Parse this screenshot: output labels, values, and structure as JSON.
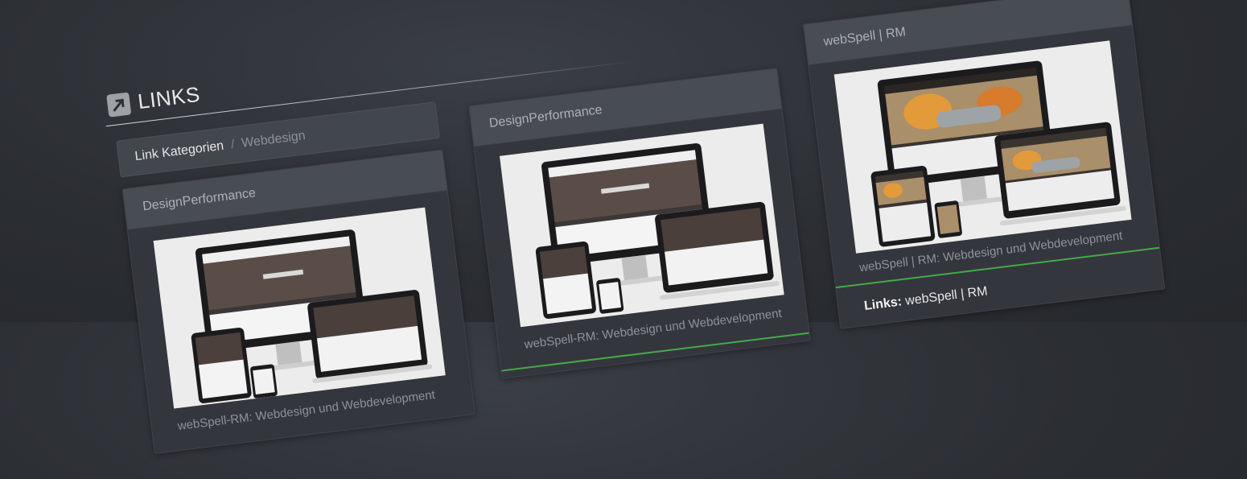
{
  "page": {
    "title": "LINKS",
    "title_icon": "arrow-up-right-icon"
  },
  "breadcrumb": {
    "root": "Link Kategorien",
    "separator": "/",
    "current": "Webdesign"
  },
  "cards": [
    {
      "title": "DesignPerformance",
      "caption": "webSpell-RM: Webdesign und Webdevelopment",
      "links_label": "",
      "links_value": ""
    },
    {
      "title": "DesignPerformance",
      "caption": "webSpell-RM: Webdesign und Webdevelopment",
      "links_label": "",
      "links_value": ""
    },
    {
      "title": "webSpell | RM",
      "caption": "webSpell | RM: Webdesign und Webdevelopment",
      "links_label": "Links:",
      "links_value": "webSpell | RM"
    }
  ],
  "colors": {
    "accent_green": "#46a84a",
    "background": "#2b2e33",
    "card": "#33363c",
    "card_header": "#484c53"
  }
}
